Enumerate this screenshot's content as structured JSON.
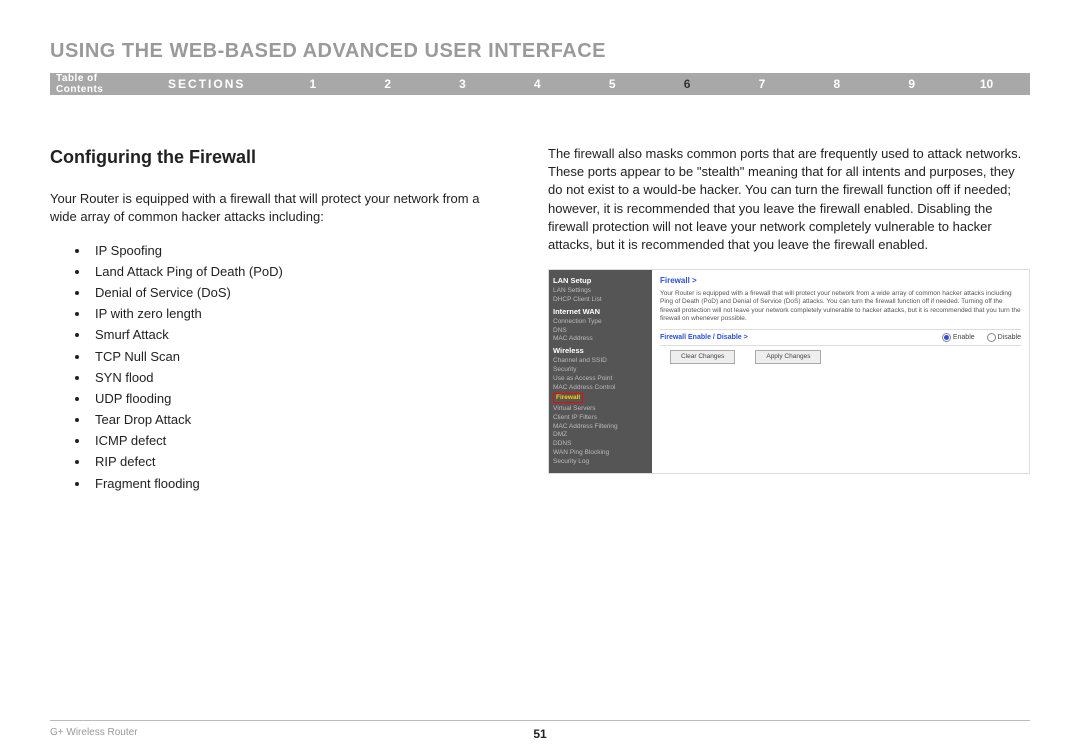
{
  "header": {
    "title": "USING THE WEB-BASED ADVANCED USER INTERFACE",
    "toc": "Table of Contents",
    "sections_label": "SECTIONS",
    "sections": [
      "1",
      "2",
      "3",
      "4",
      "5",
      "6",
      "7",
      "8",
      "9",
      "10"
    ],
    "active_section": "6"
  },
  "left": {
    "heading": "Configuring the Firewall",
    "intro": "Your Router is equipped with a firewall that will protect your network from a wide array of common hacker attacks including:",
    "bullets": [
      "IP Spoofing",
      "Land Attack Ping of Death (PoD)",
      "Denial of Service (DoS)",
      "IP with zero length",
      "Smurf Attack",
      "TCP Null Scan",
      "SYN flood",
      "UDP flooding",
      "Tear Drop Attack",
      "ICMP defect",
      "RIP defect",
      "Fragment flooding"
    ]
  },
  "right": {
    "paragraph": "The firewall also masks common ports that are frequently used to attack networks. These ports appear to be \"stealth\" meaning that for all intents and purposes, they do not exist to a would-be hacker. You can turn the firewall function off if needed; however, it is recommended that you leave the firewall enabled. Disabling the firewall protection will not leave your network completely vulnerable to hacker attacks, but it is recommended that you leave the firewall enabled."
  },
  "router_ui": {
    "sidebar": {
      "group1_head": "LAN Setup",
      "group1_items": [
        "LAN Settings",
        "DHCP Client List"
      ],
      "group2_head": "Internet WAN",
      "group2_items": [
        "Connection Type",
        "DNS",
        "MAC Address"
      ],
      "group3_head": "Wireless",
      "group3_items": [
        "Channel and SSID",
        "Security",
        "Use as Access Point",
        "MAC Address Control"
      ],
      "highlight": "Firewall",
      "group3_after": [
        "Virtual Servers",
        "Client IP Filters",
        "MAC Address Filtering",
        "DMZ",
        "DDNS",
        "WAN Ping Blocking",
        "Security Log"
      ]
    },
    "main": {
      "title": "Firewall >",
      "desc": "Your Router is equipped with a firewall that will protect your network from a wide array of common hacker attacks including Ping of Death (PoD) and Denial of Service (DoS) attacks. You can turn the firewall function off if needed. Turning off the firewall protection will not leave your network completely vulnerable to hacker attacks, but it is recommended that you turn the firewall on whenever possible.",
      "row_label": "Firewall Enable / Disable >",
      "enable": "Enable",
      "disable": "Disable",
      "clear_btn": "Clear Changes",
      "apply_btn": "Apply Changes"
    }
  },
  "footer": {
    "left": "G+ Wireless Router",
    "page": "51"
  }
}
